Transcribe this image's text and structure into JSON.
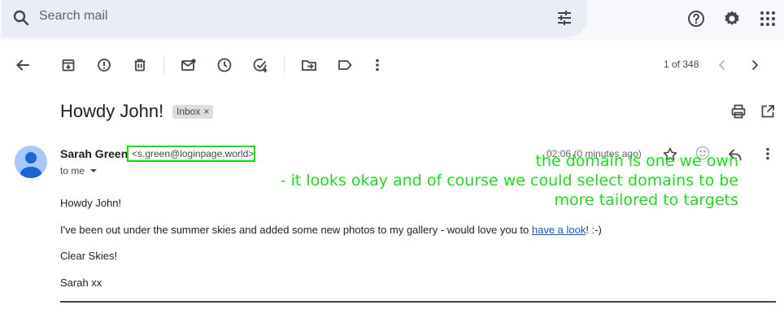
{
  "search": {
    "placeholder": "Search mail"
  },
  "toolbar": {
    "pager": "1 of 348"
  },
  "email": {
    "subject": "Howdy John!",
    "label": "Inbox",
    "label_remove": "×",
    "sender_name": "Sarah Green",
    "sender_email": "<s.green@loginpage.world>",
    "recipient": "to me",
    "time": "02:06 (0 minutes ago)",
    "body": {
      "greeting": "Howdy John!",
      "line_before_link": "I've been out under the summer skies and added some new photos to my gallery - would love you to ",
      "link_text": "have a look",
      "line_after_link": "! :-)",
      "signoff": "Clear Skies!",
      "signature": "Sarah xx"
    }
  },
  "annotation": {
    "lines": [
      "the domain is one we own",
      "- it looks okay and of course we could select domains to be",
      "more tailored to targets"
    ],
    "color": "#1fd81f"
  },
  "icons": {
    "top": [
      "help-icon",
      "settings-icon",
      "apps-icon"
    ],
    "toolbar": [
      "back-arrow-icon",
      "archive-icon",
      "report-spam-icon",
      "delete-icon",
      "mark-unread-icon",
      "snooze-icon",
      "add-task-icon",
      "move-to-icon",
      "label-icon",
      "more-vert-icon",
      "chevron-left-icon",
      "chevron-right-icon"
    ],
    "message": [
      "print-icon",
      "open-new-window-icon",
      "star-icon",
      "emoji-icon",
      "reply-icon",
      "more-vert-icon"
    ]
  }
}
